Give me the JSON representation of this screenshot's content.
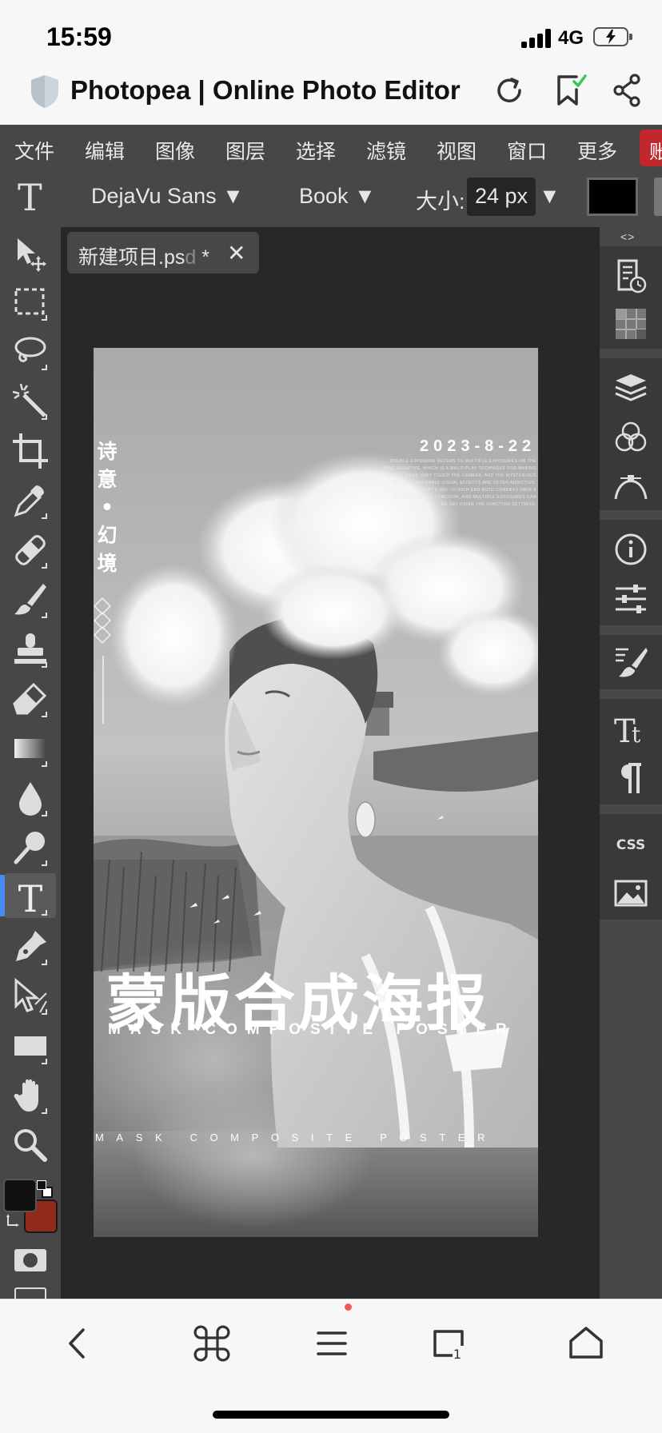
{
  "status_bar": {
    "time": "15:59",
    "network": "4G"
  },
  "browser": {
    "title": "Photopea | Online Photo Editor"
  },
  "menu": {
    "items": [
      "文件",
      "编辑",
      "图像",
      "图层",
      "选择",
      "滤镜",
      "视图",
      "窗口",
      "更多"
    ],
    "account_label": "账"
  },
  "options": {
    "font_family": "DejaVu Sans ▼",
    "font_style": "Book ▼",
    "size_label": "大小:",
    "size_value": "24 px",
    "size_dropdown": "▼"
  },
  "document": {
    "tab_name": "新建项目.ps",
    "tab_name_fade": "d",
    "tab_modified": "*",
    "close_glyph": "✕"
  },
  "right_panel": {
    "collapse_label": "<>"
  },
  "poster": {
    "date": "2023-8-22",
    "vertical_title": [
      "诗",
      "意",
      "•",
      "幻",
      "境"
    ],
    "small_text": [
      "DOUBLE EXPOSURE REFERS TO MULTIPLE EXPOSURES ON THE",
      "SAME NEGATIVE, WHICH IS A MULTI-PLAY TECHNIQUE FOR MAKING",
      "PEOPLE WHEN THEY TOUCH THE CAMERA, AND THE MYSTERIOUS",
      "AND INDESCRIBABLE VISUAL EFFECTS ARE OFTEN ADDICTIVE.",
      "TODAY'S MID-TO-HIGH END AUTO CAMERAS HAVE A",
      "MULTI-EXPOSURE FUNCTION, AND MULTIPLE EXPOSURES CAN",
      "BE SET USING THE FUNCTION SETTINGS."
    ],
    "main_title": "蒙版合成海报",
    "subtitle": "MASK COMPOSITE POSTER",
    "bottom_subtitle": "MASK COMPOSITE POSTER"
  },
  "colors": {
    "accent_active_tool": "#4a8cf7",
    "foreground_swatch": "#111111",
    "background_swatch": "#8f2a1c",
    "account_button": "#c1272d"
  }
}
